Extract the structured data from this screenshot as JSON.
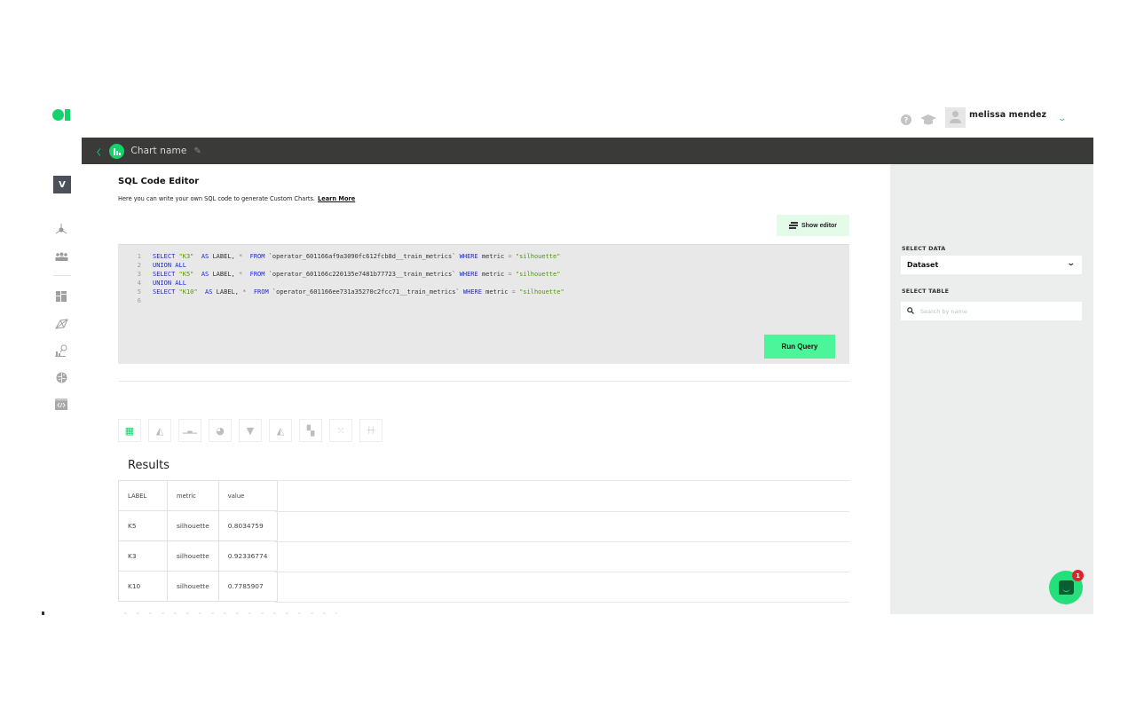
{
  "header": {
    "logo": "logo-icon",
    "help_icon": "help-icon",
    "help_glyph": "?",
    "learn_icon": "graduation-cap-icon",
    "user": {
      "name": "melissa mendez",
      "avatar": "avatar-icon",
      "menu_icon": "chevron-down-icon",
      "menu_glyph": "⌄"
    }
  },
  "topbar": {
    "back_glyph": "‹",
    "chart_name": "Chart name",
    "edit_glyph": "✎"
  },
  "sidebar": {
    "workspace_initial": "V",
    "items": [
      {
        "name": "hierarchy",
        "glyph": "⋔"
      },
      {
        "name": "users",
        "glyph": "👥"
      },
      {
        "name": "dashboard",
        "glyph": "▦"
      },
      {
        "name": "models",
        "glyph": "⟁"
      },
      {
        "name": "analytics-search",
        "glyph": "⌕"
      },
      {
        "name": "brain",
        "glyph": "✺"
      },
      {
        "name": "code",
        "glyph": "</>"
      }
    ]
  },
  "editor": {
    "title": "SQL Code Editor",
    "subtitle": "Here you can write your own SQL code to generate Custom Charts.",
    "learn_more": "Learn More",
    "show_editor_label": "Show editor",
    "run_query_label": "Run Query",
    "lines": [
      {
        "n": "1",
        "tokens": [
          [
            "kw",
            "SELECT "
          ],
          [
            "str",
            "\"K3\""
          ],
          [
            "tx",
            "  "
          ],
          [
            "kw",
            "AS"
          ],
          [
            "tx",
            " LABEL, "
          ],
          [
            "op",
            "*"
          ],
          [
            "tx",
            "  "
          ],
          [
            "kw",
            "FROM"
          ],
          [
            "tx",
            " `operator_601166af9a3090fc612fcb8d__train_metrics` "
          ],
          [
            "kw",
            "WHERE"
          ],
          [
            "tx",
            " metric "
          ],
          [
            "op",
            "="
          ],
          [
            "tx",
            " "
          ],
          [
            "str",
            "\"silhouette\""
          ]
        ]
      },
      {
        "n": "2",
        "tokens": [
          [
            "kw",
            "UNION ALL"
          ]
        ]
      },
      {
        "n": "3",
        "tokens": [
          [
            "kw",
            "SELECT "
          ],
          [
            "str",
            "\"K5\""
          ],
          [
            "tx",
            "  "
          ],
          [
            "kw",
            "AS"
          ],
          [
            "tx",
            " LABEL, "
          ],
          [
            "op",
            "*"
          ],
          [
            "tx",
            "  "
          ],
          [
            "kw",
            "FROM"
          ],
          [
            "tx",
            " `operator_601166c220135e7481b77723__train_metrics` "
          ],
          [
            "kw",
            "WHERE"
          ],
          [
            "tx",
            " metric "
          ],
          [
            "op",
            "="
          ],
          [
            "tx",
            " "
          ],
          [
            "str",
            "\"silhouette\""
          ]
        ]
      },
      {
        "n": "4",
        "tokens": [
          [
            "kw",
            "UNION ALL"
          ]
        ]
      },
      {
        "n": "5",
        "tokens": [
          [
            "kw",
            "SELECT "
          ],
          [
            "str",
            "\"K10\""
          ],
          [
            "tx",
            "  "
          ],
          [
            "kw",
            "AS"
          ],
          [
            "tx",
            " LABEL, "
          ],
          [
            "op",
            "*"
          ],
          [
            "tx",
            "  "
          ],
          [
            "kw",
            "FROM"
          ],
          [
            "tx",
            " `operator_601166ee731a35270c2fcc71__train_metrics` "
          ],
          [
            "kw",
            "WHERE"
          ],
          [
            "tx",
            " metric "
          ],
          [
            "op",
            "="
          ],
          [
            "tx",
            " "
          ],
          [
            "str",
            "\"silhouette\""
          ]
        ]
      },
      {
        "n": "6",
        "tokens": []
      }
    ]
  },
  "chart_types": [
    {
      "name": "table",
      "glyph": "▦",
      "active": true
    },
    {
      "name": "area",
      "glyph": "◭",
      "active": false
    },
    {
      "name": "bar",
      "glyph": "▁▃▁",
      "active": false
    },
    {
      "name": "pie",
      "glyph": "◕",
      "active": false
    },
    {
      "name": "funnel",
      "glyph": "▼",
      "active": false
    },
    {
      "name": "stacked-area",
      "glyph": "◭",
      "active": false
    },
    {
      "name": "treemap",
      "glyph": "▚",
      "active": false
    },
    {
      "name": "scatter",
      "glyph": "⁙",
      "active": false
    },
    {
      "name": "box-plot",
      "glyph": "┼┼",
      "active": false
    }
  ],
  "results": {
    "title": "Results",
    "columns": [
      "LABEL",
      "metric",
      "value"
    ],
    "rows": [
      [
        "K5",
        "silhouette",
        "0.8034759"
      ],
      [
        "K3",
        "silhouette",
        "0.92336774"
      ],
      [
        "K10",
        "silhouette",
        "0.7785907"
      ]
    ]
  },
  "right_panel": {
    "select_data_label": "SELECT DATA",
    "select_data_value": "Dataset",
    "select_table_label": "SELECT TABLE",
    "search_placeholder": "Search by name"
  },
  "chat": {
    "unread_count": "1"
  },
  "colors": {
    "accent": "#12d46a",
    "run_button": "#4df59a",
    "show_editor_bg": "#e4fbe9",
    "topbar_bg": "#3a3a38",
    "right_panel_bg": "#eceded",
    "sql_keyword": "#1b2bd6",
    "sql_string": "#4d9a06",
    "badge": "#d9262c"
  }
}
